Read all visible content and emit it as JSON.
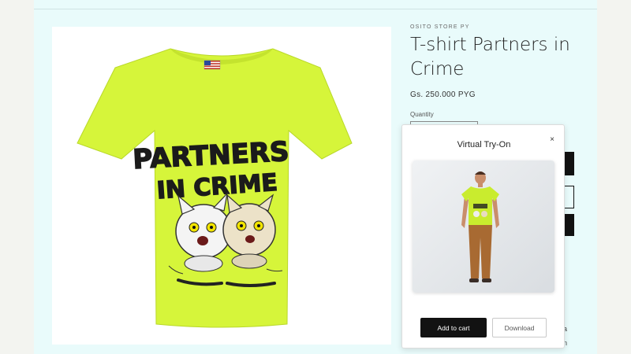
{
  "product": {
    "vendor": "OSITO STORE PY",
    "title": "T-shirt Partners in Crime",
    "price": "Gs. 250.000 PYG",
    "quantity_label": "Quantity",
    "image_alt": "Neon yellow t-shirt with Partners in Crime cats print",
    "print_text": [
      "PARTNERS",
      "IN CRIME"
    ],
    "shirt_color": "#d6f53a"
  },
  "modal": {
    "title": "Virtual Try-On",
    "close_glyph": "×",
    "preview_icon": "person-wearing-shirt",
    "add_to_cart_label": "Add to cart",
    "download_label": "Download"
  },
  "peeks": [
    "a",
    "n"
  ],
  "colors": {
    "page_bg": "#e9fbfb",
    "button_dark": "#121212",
    "shirt": "#d6f53a"
  }
}
